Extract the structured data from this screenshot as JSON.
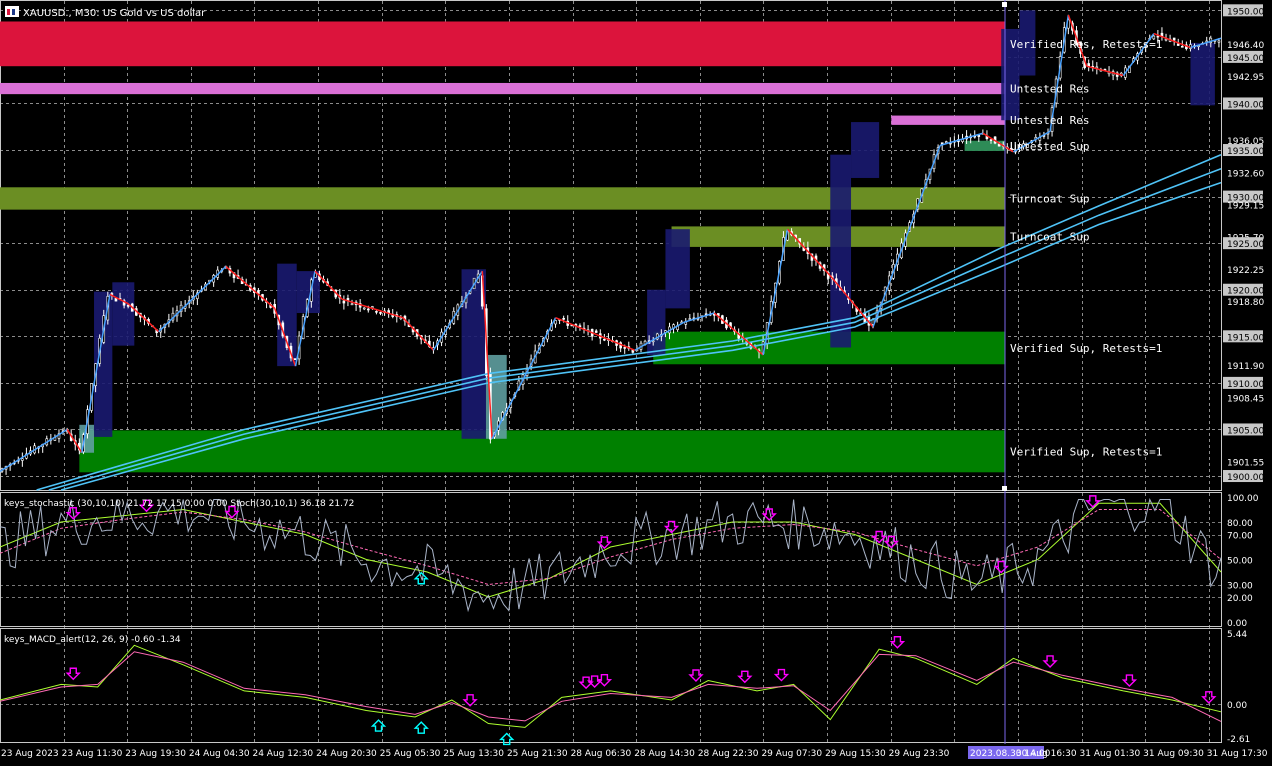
{
  "header": {
    "symbol_title": "XAUUSD., M30: US Gold vs US dollar",
    "icon": "chart-icon"
  },
  "colors": {
    "background": "#000000",
    "grid": "#c8c8c8",
    "bull": "#ffffff",
    "bear": "#ffffff",
    "zone_res_verified": "#dc143c",
    "zone_res_untested": "#da70d6",
    "zone_sup_turncoat": "#6b8e23",
    "zone_sup_verified": "#008000",
    "zone_sup_untested": "#2e8b57",
    "box_fill": "#191970",
    "box_fill_light": "#5f9ea0",
    "zigzag_up": "#4aa3ff",
    "zigzag_down": "#ff2020",
    "ma": "#4fc3f7",
    "stoch_main": "#adff2f",
    "stoch_signal": "#ff69b4",
    "stoch_raw": "#a9b4c8",
    "macd_main": "#adff2f",
    "macd_signal": "#ff69b4",
    "arrow_down": "#ff00ff",
    "arrow_up": "#00ffff",
    "separator": "#7b68ee"
  },
  "zone_labels": [
    "Verified Res, Retests=1",
    "Untested Res",
    "Untested Res",
    "Untested Sup",
    "Turncoat Sup",
    "Turncoat Sup",
    "Verified Sup, Retests=1",
    "Verified Sup, Retests=1"
  ],
  "chart_data": [
    {
      "type": "candlestick",
      "title": "XAUUSD., M30: US Gold vs US dollar",
      "price_axis_labels": [
        "1950.00",
        "1946.40",
        "1945.00",
        "1942.95",
        "1940.00",
        "1936.05",
        "1935.00",
        "1932.60",
        "1930.00",
        "1929.15",
        "1925.70",
        "1925.00",
        "1922.25",
        "1920.00",
        "1918.80",
        "1915.00",
        "1911.90",
        "1910.00",
        "1908.45",
        "1905.00",
        "1901.55",
        "1900.00"
      ],
      "highlighted_levels": [
        "1950.00",
        "1945.00",
        "1940.00",
        "1935.00",
        "1930.00",
        "1925.00",
        "1920.00",
        "1915.00",
        "1910.00",
        "1905.00",
        "1900.00"
      ],
      "ylim": [
        1898.5,
        1951.0
      ],
      "x_labels": [
        "23 Aug 2023",
        "23 Aug 11:30",
        "23 Aug 19:30",
        "24 Aug 04:30",
        "24 Aug 12:30",
        "24 Aug 20:30",
        "25 Aug 05:30",
        "25 Aug 13:30",
        "25 Aug 21:30",
        "28 Aug 06:30",
        "28 Aug 14:30",
        "28 Aug 22:30",
        "29 Aug 07:30",
        "29 Aug 15:30",
        "29 Aug 23:30",
        "2023.08.30 14:00",
        "30 Aug 16:30",
        "31 Aug 01:30",
        "31 Aug 09:30",
        "31 Aug 17:30"
      ],
      "zones": [
        {
          "label": "Verified Res, Retests=1",
          "from": 1944.0,
          "to": 1948.8,
          "kind": "zone_res_verified"
        },
        {
          "label": "Untested Res",
          "from": 1941.0,
          "to": 1942.2,
          "kind": "zone_res_untested"
        },
        {
          "label": "Untested Res",
          "from": 1937.7,
          "to": 1938.7,
          "kind": "zone_res_untested",
          "start": 0.73
        },
        {
          "label": "Untested Sup",
          "from": 1934.9,
          "to": 1936.0,
          "kind": "zone_sup_untested",
          "start": 0.79
        },
        {
          "label": "Turncoat Sup",
          "from": 1928.6,
          "to": 1931.0,
          "kind": "zone_sup_turncoat"
        },
        {
          "label": "Turncoat Sup",
          "from": 1924.6,
          "to": 1926.8,
          "kind": "zone_sup_turncoat",
          "start": 0.55
        },
        {
          "label": "Verified Sup, Retests=1",
          "from": 1912.0,
          "to": 1915.5,
          "kind": "zone_sup_verified",
          "start": 0.535
        },
        {
          "label": "Verified Sup, Retests=1",
          "from": 1900.4,
          "to": 1904.9,
          "kind": "zone_sup_verified",
          "start": 0.065
        }
      ],
      "zigzag": [
        [
          0.0,
          1900.5
        ],
        [
          0.055,
          1905.0
        ],
        [
          0.067,
          1902.5
        ],
        [
          0.09,
          1919.5
        ],
        [
          0.105,
          1918.5
        ],
        [
          0.13,
          1915.5
        ],
        [
          0.185,
          1922.5
        ],
        [
          0.225,
          1918.0
        ],
        [
          0.242,
          1911.8
        ],
        [
          0.258,
          1922.0
        ],
        [
          0.28,
          1919.0
        ],
        [
          0.33,
          1917.0
        ],
        [
          0.355,
          1913.5
        ],
        [
          0.395,
          1922.0
        ],
        [
          0.403,
          1904.0
        ],
        [
          0.455,
          1917.0
        ],
        [
          0.52,
          1913.5
        ],
        [
          0.56,
          1916.5
        ],
        [
          0.585,
          1917.5
        ],
        [
          0.625,
          1913.0
        ],
        [
          0.645,
          1926.5
        ],
        [
          0.68,
          1921.5
        ],
        [
          0.715,
          1916.0
        ],
        [
          0.77,
          1935.5
        ],
        [
          0.805,
          1936.8
        ],
        [
          0.83,
          1934.8
        ],
        [
          0.86,
          1937.0
        ],
        [
          0.875,
          1949.5
        ],
        [
          0.89,
          1944.0
        ],
        [
          0.92,
          1943.0
        ],
        [
          0.945,
          1947.5
        ],
        [
          0.975,
          1946.0
        ],
        [
          1.0,
          1947.0
        ]
      ],
      "moving_averages": {
        "series": [
          {
            "values": [
              [
                0.03,
                1898.5
              ],
              [
                0.2,
                1905.0
              ],
              [
                0.4,
                1911.0
              ],
              [
                0.6,
                1914.5
              ],
              [
                0.7,
                1917.0
              ],
              [
                0.82,
                1924.5
              ],
              [
                0.9,
                1929.0
              ],
              [
                1.0,
                1934.5
              ]
            ]
          },
          {
            "values": [
              [
                0.04,
                1898.5
              ],
              [
                0.2,
                1904.5
              ],
              [
                0.4,
                1910.5
              ],
              [
                0.6,
                1914.0
              ],
              [
                0.7,
                1916.5
              ],
              [
                0.82,
                1923.5
              ],
              [
                0.9,
                1928.0
              ],
              [
                1.0,
                1933.0
              ]
            ]
          },
          {
            "values": [
              [
                0.05,
                1898.5
              ],
              [
                0.2,
                1904.0
              ],
              [
                0.4,
                1910.0
              ],
              [
                0.6,
                1913.5
              ],
              [
                0.7,
                1916.0
              ],
              [
                0.82,
                1922.5
              ],
              [
                0.9,
                1927.0
              ],
              [
                1.0,
                1931.5
              ]
            ]
          }
        ]
      }
    },
    {
      "type": "line",
      "title": "keys_stochastic (30,10,10) 21.72 17.15 0.00 0.00 Stoch(30,10,1) 36.18 21.72",
      "axis_labels": [
        "100.00",
        "80.00",
        "70.00",
        "50.00",
        "30.00",
        "20.00",
        "0.00"
      ],
      "ylim": [
        0,
        100
      ],
      "series": [
        {
          "values": [
            [
              0.0,
              60
            ],
            [
              0.05,
              80
            ],
            [
              0.1,
              85
            ],
            [
              0.15,
              90
            ],
            [
              0.2,
              80
            ],
            [
              0.25,
              70
            ],
            [
              0.3,
              50
            ],
            [
              0.35,
              40
            ],
            [
              0.4,
              20
            ],
            [
              0.45,
              35
            ],
            [
              0.5,
              60
            ],
            [
              0.55,
              70
            ],
            [
              0.6,
              80
            ],
            [
              0.65,
              80
            ],
            [
              0.7,
              70
            ],
            [
              0.75,
              50
            ],
            [
              0.8,
              30
            ],
            [
              0.85,
              50
            ],
            [
              0.9,
              95
            ],
            [
              0.95,
              95
            ],
            [
              1.0,
              40
            ]
          ]
        },
        {
          "values": [
            [
              0.0,
              55
            ],
            [
              0.05,
              75
            ],
            [
              0.1,
              82
            ],
            [
              0.15,
              88
            ],
            [
              0.2,
              82
            ],
            [
              0.25,
              72
            ],
            [
              0.3,
              58
            ],
            [
              0.35,
              45
            ],
            [
              0.4,
              30
            ],
            [
              0.45,
              35
            ],
            [
              0.5,
              52
            ],
            [
              0.55,
              66
            ],
            [
              0.6,
              75
            ],
            [
              0.65,
              78
            ],
            [
              0.7,
              72
            ],
            [
              0.75,
              58
            ],
            [
              0.8,
              45
            ],
            [
              0.85,
              60
            ],
            [
              0.9,
              90
            ],
            [
              0.95,
              90
            ],
            [
              1.0,
              50
            ]
          ]
        }
      ],
      "arrows_down": [
        0.06,
        0.12,
        0.19,
        0.495,
        0.55,
        0.63,
        0.72,
        0.73,
        0.82,
        0.895
      ],
      "arrows_up": [
        0.345
      ]
    },
    {
      "type": "line",
      "title": "keys_MACD_alert(12, 26, 9) -0.60 -1.34",
      "axis_labels": [
        "5.44",
        "0.00",
        "-2.61"
      ],
      "ylim": [
        -2.61,
        5.44
      ],
      "series": [
        {
          "values": [
            [
              0.0,
              0.3
            ],
            [
              0.05,
              1.5
            ],
            [
              0.08,
              1.3
            ],
            [
              0.11,
              4.5
            ],
            [
              0.15,
              3.0
            ],
            [
              0.2,
              1.0
            ],
            [
              0.25,
              0.5
            ],
            [
              0.3,
              -0.5
            ],
            [
              0.34,
              -1.0
            ],
            [
              0.37,
              0.3
            ],
            [
              0.4,
              -1.5
            ],
            [
              0.43,
              -1.8
            ],
            [
              0.46,
              0.5
            ],
            [
              0.5,
              1.0
            ],
            [
              0.55,
              0.3
            ],
            [
              0.58,
              1.8
            ],
            [
              0.62,
              1.0
            ],
            [
              0.65,
              1.5
            ],
            [
              0.68,
              -1.2
            ],
            [
              0.72,
              4.2
            ],
            [
              0.75,
              3.5
            ],
            [
              0.8,
              1.5
            ],
            [
              0.83,
              3.5
            ],
            [
              0.87,
              2.0
            ],
            [
              0.92,
              1.0
            ],
            [
              0.96,
              0.3
            ],
            [
              1.0,
              -0.6
            ]
          ]
        },
        {
          "values": [
            [
              0.0,
              0.2
            ],
            [
              0.05,
              1.3
            ],
            [
              0.08,
              1.5
            ],
            [
              0.11,
              4.0
            ],
            [
              0.15,
              3.2
            ],
            [
              0.2,
              1.2
            ],
            [
              0.25,
              0.7
            ],
            [
              0.3,
              -0.2
            ],
            [
              0.34,
              -0.8
            ],
            [
              0.37,
              0.1
            ],
            [
              0.4,
              -1.0
            ],
            [
              0.43,
              -1.3
            ],
            [
              0.46,
              0.2
            ],
            [
              0.5,
              0.8
            ],
            [
              0.55,
              0.5
            ],
            [
              0.58,
              1.5
            ],
            [
              0.62,
              1.2
            ],
            [
              0.65,
              1.4
            ],
            [
              0.68,
              -0.5
            ],
            [
              0.72,
              3.8
            ],
            [
              0.75,
              3.7
            ],
            [
              0.8,
              1.8
            ],
            [
              0.83,
              3.2
            ],
            [
              0.87,
              2.2
            ],
            [
              0.92,
              1.2
            ],
            [
              0.96,
              0.5
            ],
            [
              1.0,
              -1.34
            ]
          ]
        }
      ],
      "arrows_down": [
        0.06,
        0.385,
        0.48,
        0.487,
        0.495,
        0.57,
        0.61,
        0.64,
        0.735,
        0.86,
        0.925,
        0.99
      ],
      "arrows_up": [
        0.31,
        0.345,
        0.415
      ]
    }
  ]
}
